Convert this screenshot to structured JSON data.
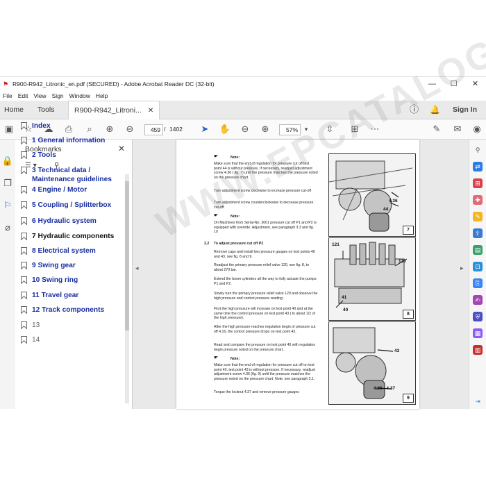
{
  "window": {
    "title": "R900-R942_Litronic_en.pdf (SECURED) - Adobe Acrobat Reader DC (32-bit)",
    "menu": [
      "File",
      "Edit",
      "View",
      "Sign",
      "Window",
      "Help"
    ],
    "controls": [
      "minimize-icon",
      "maximize-icon",
      "close-icon"
    ]
  },
  "tabs": {
    "home": "Home",
    "tools": "Tools",
    "doc": "R900-R942_Litroni...",
    "sign_in": "Sign In"
  },
  "toolbar": {
    "page_current": "459",
    "page_sep": "/",
    "page_total": "1402",
    "zoom": "57%"
  },
  "bookmarks": {
    "title": "Bookmarks",
    "items": [
      {
        "label": "Index"
      },
      {
        "label": "1 General information"
      },
      {
        "label": "2 Tools"
      },
      {
        "label": "3 Technical data / Maintenance guidelines"
      },
      {
        "label": "4 Engine / Motor"
      },
      {
        "label": "5 Coupling / Splitterbox"
      },
      {
        "label": "6 Hydraulic system"
      },
      {
        "label": "7 Hydraulic components"
      },
      {
        "label": "8 Electrical system"
      },
      {
        "label": "9 Swing gear"
      },
      {
        "label": "10 Swing ring"
      },
      {
        "label": "11 Travel gear"
      },
      {
        "label": "12 Track components"
      },
      {
        "label": "13"
      },
      {
        "label": "14"
      }
    ],
    "selected_index": 7
  },
  "pdf": {
    "note1_label": "Note:",
    "note1": "Make sure that the end of regulation for pressure cut off test point 44 is without pressure. If necessary, readjust adjustment screw 4.36 ( fig. 7) until the pressure matches the pressure noted on the pressure chart.",
    "p_cw": "Turn adjustment screw clockwise to increase pressure cut-off",
    "p_ccw": "Turn adjustment screw counterclockwise to decrease pressure cut-off",
    "note2_label": "Note:",
    "note2": "On Machines from Serial-No. 3001 pressure cut off P1 and P2 is equipped with override. Adjustment, see paragraph 3.3 and fig. 10",
    "sec_num": "3.2",
    "sec_title": "To adjust pressure cut off P2",
    "p1": "Remove caps and install two pressure gauges on test points 40 and 43, see fig. 8 and 9.",
    "p2": "Readjust the primary pressure relief valve 120, see fig. 8, to about 270 bar.",
    "p3": "Extend the boom cylinders all the way to fully actuate the pumps P1 and P2.",
    "p4": "Slowly turn the primary pressure relief valve 120 and observe the high pressure and control pressure reading.",
    "p5": "First the high pressure will increase on test point 40 and at the same time the control pressure on test point 43 ( to about 1/2 of the high pressure).",
    "p6": "After the high pressure reaches regulation begin of pressure cut off 4.16, the control pressure drops on test point 43.",
    "p7": "Read and compare the pressure on test point 40 with regulation begin pressure noted on the pressure chart.",
    "note3_label": "Note:",
    "note3": "Make sure that the end of regulation for pressure cut off on test point 40, test point 43 is without pressure. If necessary, readjust adjustment screw 4.36 (fig. 9) until the pressure matches the pressure noted on the pressure chart. Note, see paragraph 3.1.",
    "p8": "Torque the locknut 4.37 and remove pressure gauges",
    "fig7": {
      "num": "7",
      "c1": "4.36",
      "c2": "44"
    },
    "fig8": {
      "num": "8",
      "c1": "121",
      "c2": "120",
      "c3": "41",
      "c4": "40"
    },
    "fig9": {
      "num": "9",
      "c1": "43",
      "c2": "4.36 - 4.37"
    }
  },
  "watermark": "WWW.EPCATALOGS.COM"
}
